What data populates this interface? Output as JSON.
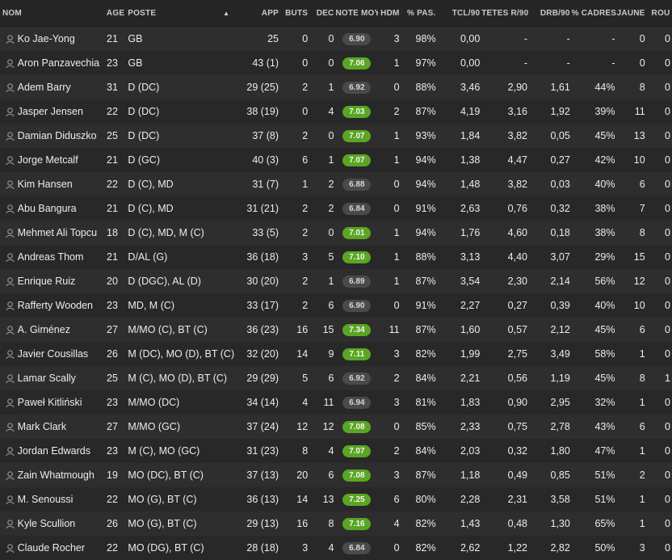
{
  "headers": {
    "nom": "NOM",
    "age": "ÂGE",
    "poste": "POSTE",
    "app": "APP",
    "buts": "BUTS",
    "dec": "DÉC",
    "note": "NOTE MOY",
    "hdm": "HDM",
    "pas": "% PAS.",
    "tcl": "TCL/90",
    "tetes": "TÊTES R/90",
    "drb": "DRB/90",
    "cadres": "% CADRÉS",
    "jaune": "JAUNE",
    "rouge": "ROU"
  },
  "sort_indicator": "▲",
  "badge_colors": {
    "green": "#5aa624",
    "grey": "#4a4a4a"
  },
  "players": [
    {
      "name": "Ko Jae-Yong",
      "age": "21",
      "pos": "GB",
      "app": "25",
      "buts": "0",
      "dec": "0",
      "note": "6.90",
      "note_color": "grey",
      "hdm": "3",
      "pas": "98%",
      "tcl": "0,00",
      "tetes": "-",
      "drb": "-",
      "cad": "-",
      "jaune": "0",
      "rouge": "0"
    },
    {
      "name": "Aron Panzavechia",
      "age": "23",
      "pos": "GB",
      "app": "43 (1)",
      "buts": "0",
      "dec": "0",
      "note": "7.06",
      "note_color": "green",
      "hdm": "1",
      "pas": "97%",
      "tcl": "0,00",
      "tetes": "-",
      "drb": "-",
      "cad": "-",
      "jaune": "0",
      "rouge": "0"
    },
    {
      "name": "Adem Barry",
      "age": "31",
      "pos": "D (DC)",
      "app": "29 (25)",
      "buts": "2",
      "dec": "1",
      "note": "6.92",
      "note_color": "grey",
      "hdm": "0",
      "pas": "88%",
      "tcl": "3,46",
      "tetes": "2,90",
      "drb": "1,61",
      "cad": "44%",
      "jaune": "8",
      "rouge": "0"
    },
    {
      "name": "Jasper Jensen",
      "age": "22",
      "pos": "D (DC)",
      "app": "38 (19)",
      "buts": "0",
      "dec": "4",
      "note": "7.03",
      "note_color": "green",
      "hdm": "2",
      "pas": "87%",
      "tcl": "4,19",
      "tetes": "3,16",
      "drb": "1,92",
      "cad": "39%",
      "jaune": "11",
      "rouge": "0"
    },
    {
      "name": "Damian Diduszko",
      "age": "25",
      "pos": "D (DC)",
      "app": "37 (8)",
      "buts": "2",
      "dec": "0",
      "note": "7.07",
      "note_color": "green",
      "hdm": "1",
      "pas": "93%",
      "tcl": "1,84",
      "tetes": "3,82",
      "drb": "0,05",
      "cad": "45%",
      "jaune": "13",
      "rouge": "0"
    },
    {
      "name": "Jorge Metcalf",
      "age": "21",
      "pos": "D (GC)",
      "app": "40 (3)",
      "buts": "6",
      "dec": "1",
      "note": "7.07",
      "note_color": "green",
      "hdm": "1",
      "pas": "94%",
      "tcl": "1,38",
      "tetes": "4,47",
      "drb": "0,27",
      "cad": "42%",
      "jaune": "10",
      "rouge": "0"
    },
    {
      "name": "Kim Hansen",
      "age": "22",
      "pos": "D (C), MD",
      "app": "31 (7)",
      "buts": "1",
      "dec": "2",
      "note": "6.88",
      "note_color": "grey",
      "hdm": "0",
      "pas": "94%",
      "tcl": "1,48",
      "tetes": "3,82",
      "drb": "0,03",
      "cad": "40%",
      "jaune": "6",
      "rouge": "0"
    },
    {
      "name": "Abu Bangura",
      "age": "21",
      "pos": "D (C), MD",
      "app": "31 (21)",
      "buts": "2",
      "dec": "2",
      "note": "6.84",
      "note_color": "grey",
      "hdm": "0",
      "pas": "91%",
      "tcl": "2,63",
      "tetes": "0,76",
      "drb": "0,32",
      "cad": "38%",
      "jaune": "7",
      "rouge": "0"
    },
    {
      "name": "Mehmet Ali Topcu",
      "age": "18",
      "pos": "D (C), MD, M (C)",
      "app": "33 (5)",
      "buts": "2",
      "dec": "0",
      "note": "7.01",
      "note_color": "green",
      "hdm": "1",
      "pas": "94%",
      "tcl": "1,76",
      "tetes": "4,60",
      "drb": "0,18",
      "cad": "38%",
      "jaune": "8",
      "rouge": "0"
    },
    {
      "name": "Andreas Thom",
      "age": "21",
      "pos": "D/AL (G)",
      "app": "36 (18)",
      "buts": "3",
      "dec": "5",
      "note": "7.10",
      "note_color": "green",
      "hdm": "1",
      "pas": "88%",
      "tcl": "3,13",
      "tetes": "4,40",
      "drb": "3,07",
      "cad": "29%",
      "jaune": "15",
      "rouge": "0"
    },
    {
      "name": "Enrique Ruiz",
      "age": "20",
      "pos": "D (DGC), AL (D)",
      "app": "30 (20)",
      "buts": "2",
      "dec": "1",
      "note": "6.89",
      "note_color": "grey",
      "hdm": "1",
      "pas": "87%",
      "tcl": "3,54",
      "tetes": "2,30",
      "drb": "2,14",
      "cad": "56%",
      "jaune": "12",
      "rouge": "0"
    },
    {
      "name": "Rafferty Wooden",
      "age": "23",
      "pos": "MD, M (C)",
      "app": "33 (17)",
      "buts": "2",
      "dec": "6",
      "note": "6.90",
      "note_color": "grey",
      "hdm": "0",
      "pas": "91%",
      "tcl": "2,27",
      "tetes": "0,27",
      "drb": "0,39",
      "cad": "40%",
      "jaune": "10",
      "rouge": "0"
    },
    {
      "name": "A. Giménez",
      "age": "27",
      "pos": "M/MO (C), BT (C)",
      "app": "36 (23)",
      "buts": "16",
      "dec": "15",
      "note": "7.34",
      "note_color": "green",
      "hdm": "11",
      "pas": "87%",
      "tcl": "1,60",
      "tetes": "0,57",
      "drb": "2,12",
      "cad": "45%",
      "jaune": "6",
      "rouge": "0"
    },
    {
      "name": "Javier Cousillas",
      "age": "26",
      "pos": "M (DC), MO (D), BT (C)",
      "app": "32 (20)",
      "buts": "14",
      "dec": "9",
      "note": "7.11",
      "note_color": "green",
      "hdm": "3",
      "pas": "82%",
      "tcl": "1,99",
      "tetes": "2,75",
      "drb": "3,49",
      "cad": "58%",
      "jaune": "1",
      "rouge": "0"
    },
    {
      "name": "Lamar Scally",
      "age": "25",
      "pos": "M (C), MO (D), BT (C)",
      "app": "29 (29)",
      "buts": "5",
      "dec": "6",
      "note": "6.92",
      "note_color": "grey",
      "hdm": "2",
      "pas": "84%",
      "tcl": "2,21",
      "tetes": "0,56",
      "drb": "1,19",
      "cad": "45%",
      "jaune": "8",
      "rouge": "1"
    },
    {
      "name": "Paweł Kitliński",
      "age": "23",
      "pos": "M/MO (DC)",
      "app": "34 (14)",
      "buts": "4",
      "dec": "11",
      "note": "6.94",
      "note_color": "grey",
      "hdm": "3",
      "pas": "81%",
      "tcl": "1,83",
      "tetes": "0,90",
      "drb": "2,95",
      "cad": "32%",
      "jaune": "1",
      "rouge": "0"
    },
    {
      "name": "Mark Clark",
      "age": "27",
      "pos": "M/MO (GC)",
      "app": "37 (24)",
      "buts": "12",
      "dec": "12",
      "note": "7.08",
      "note_color": "green",
      "hdm": "0",
      "pas": "85%",
      "tcl": "2,33",
      "tetes": "0,75",
      "drb": "2,78",
      "cad": "43%",
      "jaune": "6",
      "rouge": "0"
    },
    {
      "name": "Jordan Edwards",
      "age": "23",
      "pos": "M (C), MO (GC)",
      "app": "31 (23)",
      "buts": "8",
      "dec": "4",
      "note": "7.07",
      "note_color": "green",
      "hdm": "2",
      "pas": "84%",
      "tcl": "2,03",
      "tetes": "0,32",
      "drb": "1,80",
      "cad": "47%",
      "jaune": "1",
      "rouge": "0"
    },
    {
      "name": "Zain Whatmough",
      "age": "19",
      "pos": "MO (DC), BT (C)",
      "app": "37 (13)",
      "buts": "20",
      "dec": "6",
      "note": "7.08",
      "note_color": "green",
      "hdm": "3",
      "pas": "87%",
      "tcl": "1,18",
      "tetes": "0,49",
      "drb": "0,85",
      "cad": "51%",
      "jaune": "2",
      "rouge": "0"
    },
    {
      "name": "M. Senoussi",
      "age": "22",
      "pos": "MO (G), BT (C)",
      "app": "36 (13)",
      "buts": "14",
      "dec": "13",
      "note": "7.25",
      "note_color": "green",
      "hdm": "6",
      "pas": "80%",
      "tcl": "2,28",
      "tetes": "2,31",
      "drb": "3,58",
      "cad": "51%",
      "jaune": "1",
      "rouge": "0"
    },
    {
      "name": "Kyle Scullion",
      "age": "26",
      "pos": "MO (G), BT (C)",
      "app": "29 (13)",
      "buts": "16",
      "dec": "8",
      "note": "7.16",
      "note_color": "green",
      "hdm": "4",
      "pas": "82%",
      "tcl": "1,43",
      "tetes": "0,48",
      "drb": "1,30",
      "cad": "65%",
      "jaune": "1",
      "rouge": "0"
    },
    {
      "name": "Claude Rocher",
      "age": "22",
      "pos": "MO (DG), BT (C)",
      "app": "28 (18)",
      "buts": "3",
      "dec": "4",
      "note": "6.84",
      "note_color": "grey",
      "hdm": "0",
      "pas": "82%",
      "tcl": "2,62",
      "tetes": "1,22",
      "drb": "2,82",
      "cad": "50%",
      "jaune": "3",
      "rouge": "0"
    }
  ]
}
